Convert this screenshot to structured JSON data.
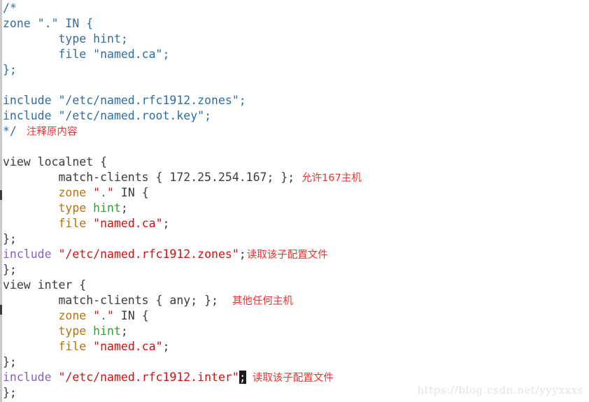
{
  "editor": {
    "background": "#ffffff",
    "watermark": "https://blog.csdn.net/yyyxxxs",
    "colors": {
      "comment_blue": "#2e6da4",
      "keyword_orange": "#b87309",
      "include_purple": "#8a5fc0",
      "string_red": "#d11111",
      "value_green": "#2f9e2f",
      "dot_teal": "#1f8a8a",
      "plain_gray": "#3b3b3b",
      "annotation_red": "#f23030",
      "cursor_block": "#1c1c1c"
    }
  },
  "lines": [
    {
      "n": 1,
      "tokens": [
        {
          "t": "/*",
          "c": "cmt"
        }
      ]
    },
    {
      "n": 2,
      "tokens": [
        {
          "t": "zone \".\" IN {",
          "c": "cmt"
        }
      ]
    },
    {
      "n": 3,
      "tokens": [
        {
          "t": "        type hint;",
          "c": "cmt"
        }
      ]
    },
    {
      "n": 4,
      "tokens": [
        {
          "t": "        file \"named.ca\";",
          "c": "cmt"
        }
      ]
    },
    {
      "n": 5,
      "tokens": [
        {
          "t": "};",
          "c": "cmt"
        }
      ]
    },
    {
      "n": 6,
      "tokens": [
        {
          "t": "",
          "c": "plain"
        }
      ]
    },
    {
      "n": 7,
      "tokens": [
        {
          "t": "include \"/etc/named.rfc1912.zones\";",
          "c": "cmt"
        }
      ]
    },
    {
      "n": 8,
      "tokens": [
        {
          "t": "include \"/etc/named.root.key\";",
          "c": "cmt"
        }
      ]
    },
    {
      "n": 9,
      "tokens": [
        {
          "t": "*/",
          "c": "cmt"
        },
        {
          "t": "注释原内容",
          "c": "anno pad"
        }
      ]
    },
    {
      "n": 10,
      "tokens": [
        {
          "t": "",
          "c": "plain"
        }
      ]
    },
    {
      "n": 11,
      "tokens": [
        {
          "t": "view localnet {",
          "c": "plain"
        }
      ]
    },
    {
      "n": 12,
      "tokens": [
        {
          "t": "        match-clients { 172.25.254.167; }; ",
          "c": "plain"
        },
        {
          "t": "允许167主机",
          "c": "anno"
        }
      ]
    },
    {
      "n": 13,
      "tokens": [
        {
          "t": "        ",
          "c": "plain"
        },
        {
          "t": "zone",
          "c": "kw"
        },
        {
          "t": " \"",
          "c": "str"
        },
        {
          "t": ".",
          "c": "dot"
        },
        {
          "t": "\"",
          "c": "str"
        },
        {
          "t": " IN {",
          "c": "plain"
        }
      ]
    },
    {
      "n": 14,
      "tokens": [
        {
          "t": "        ",
          "c": "plain"
        },
        {
          "t": "type",
          "c": "kw"
        },
        {
          "t": " ",
          "c": "plain"
        },
        {
          "t": "hint",
          "c": "val"
        },
        {
          "t": ";",
          "c": "plain"
        }
      ]
    },
    {
      "n": 15,
      "tokens": [
        {
          "t": "        ",
          "c": "plain"
        },
        {
          "t": "file",
          "c": "kw"
        },
        {
          "t": " ",
          "c": "plain"
        },
        {
          "t": "\"named.ca\"",
          "c": "str"
        },
        {
          "t": ";",
          "c": "plain"
        }
      ]
    },
    {
      "n": 16,
      "tokens": [
        {
          "t": "};",
          "c": "plain"
        }
      ]
    },
    {
      "n": 17,
      "tokens": [
        {
          "t": "include",
          "c": "inc"
        },
        {
          "t": " ",
          "c": "plain"
        },
        {
          "t": "\"/etc/named.rfc1912.zones\"",
          "c": "str"
        },
        {
          "t": ";",
          "c": "plain"
        },
        {
          "t": "读取该子配置文件",
          "c": "anno tight"
        }
      ]
    },
    {
      "n": 18,
      "tokens": [
        {
          "t": "};",
          "c": "plain"
        }
      ]
    },
    {
      "n": 19,
      "tokens": [
        {
          "t": "view inter {",
          "c": "plain"
        }
      ]
    },
    {
      "n": 20,
      "tokens": [
        {
          "t": "        match-clients { any; };  ",
          "c": "plain"
        },
        {
          "t": "其他任何主机",
          "c": "anno"
        }
      ]
    },
    {
      "n": 21,
      "tokens": [
        {
          "t": "        ",
          "c": "plain"
        },
        {
          "t": "zone",
          "c": "kw"
        },
        {
          "t": " \"",
          "c": "str"
        },
        {
          "t": ".",
          "c": "dot"
        },
        {
          "t": "\"",
          "c": "str"
        },
        {
          "t": " IN {",
          "c": "plain"
        }
      ]
    },
    {
      "n": 22,
      "tokens": [
        {
          "t": "        ",
          "c": "plain"
        },
        {
          "t": "type",
          "c": "kw"
        },
        {
          "t": " ",
          "c": "plain"
        },
        {
          "t": "hint",
          "c": "val"
        },
        {
          "t": ";",
          "c": "plain"
        }
      ]
    },
    {
      "n": 23,
      "tokens": [
        {
          "t": "        ",
          "c": "plain"
        },
        {
          "t": "file",
          "c": "kw"
        },
        {
          "t": " ",
          "c": "plain"
        },
        {
          "t": "\"named.ca\"",
          "c": "str"
        },
        {
          "t": ";",
          "c": "plain"
        }
      ]
    },
    {
      "n": 24,
      "tokens": [
        {
          "t": "};",
          "c": "plain"
        }
      ]
    },
    {
      "n": 25,
      "tokens": [
        {
          "t": "include",
          "c": "inc"
        },
        {
          "t": " ",
          "c": "plain"
        },
        {
          "t": "\"/etc/named.rfc1912.inter\"",
          "c": "str"
        },
        {
          "t": ";",
          "c": "cursor"
        },
        {
          "t": "  读取该子配置文件",
          "c": "anno"
        }
      ]
    },
    {
      "n": 26,
      "tokens": [
        {
          "t": "};",
          "c": "plain"
        }
      ]
    }
  ]
}
